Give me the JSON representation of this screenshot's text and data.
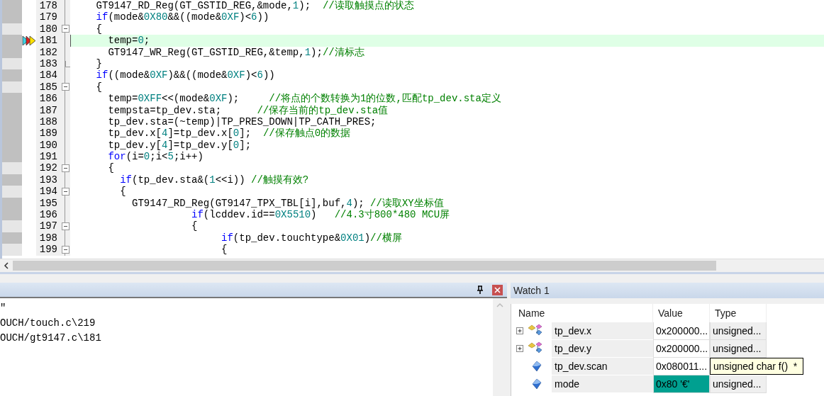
{
  "editor": {
    "lines": [
      {
        "number": "178",
        "executable": true,
        "current": false,
        "fold_start": false,
        "fold_end": false,
        "tokens": [
          {
            "kind": "code",
            "text": "    GT9147_RD_Reg(GT_GSTID_REG,&mode,"
          },
          {
            "kind": "number",
            "text": "1"
          },
          {
            "kind": "code",
            "text": ");  "
          },
          {
            "kind": "comment",
            "text": "//读取触摸点的状态"
          }
        ]
      },
      {
        "number": "179",
        "executable": true,
        "current": false,
        "fold_start": false,
        "fold_end": false,
        "tokens": [
          {
            "kind": "keyword",
            "text": "    if"
          },
          {
            "kind": "code",
            "text": "(mode&"
          },
          {
            "kind": "number",
            "text": "0X80"
          },
          {
            "kind": "code",
            "text": "&&((mode&"
          },
          {
            "kind": "number",
            "text": "0XF"
          },
          {
            "kind": "code",
            "text": ")<"
          },
          {
            "kind": "number",
            "text": "6"
          },
          {
            "kind": "code",
            "text": "))"
          }
        ]
      },
      {
        "number": "180",
        "executable": false,
        "current": false,
        "fold_start": true,
        "fold_end": false,
        "tokens": [
          {
            "kind": "code",
            "text": "    {"
          }
        ]
      },
      {
        "number": "181",
        "executable": true,
        "current": true,
        "fold_start": false,
        "fold_end": false,
        "tokens": [
          {
            "kind": "code",
            "text": "      temp="
          },
          {
            "kind": "number",
            "text": "0"
          },
          {
            "kind": "code",
            "text": ";"
          }
        ]
      },
      {
        "number": "182",
        "executable": true,
        "current": false,
        "fold_start": false,
        "fold_end": false,
        "tokens": [
          {
            "kind": "code",
            "text": "      GT9147_WR_Reg(GT_GSTID_REG,&temp,"
          },
          {
            "kind": "number",
            "text": "1"
          },
          {
            "kind": "code",
            "text": ");"
          },
          {
            "kind": "comment",
            "text": "//清标志"
          }
        ]
      },
      {
        "number": "183",
        "executable": false,
        "current": false,
        "fold_start": false,
        "fold_end": true,
        "tokens": [
          {
            "kind": "code",
            "text": "    }"
          }
        ]
      },
      {
        "number": "184",
        "executable": true,
        "current": false,
        "fold_start": false,
        "fold_end": false,
        "tokens": [
          {
            "kind": "keyword",
            "text": "    if"
          },
          {
            "kind": "code",
            "text": "((mode&"
          },
          {
            "kind": "number",
            "text": "0XF"
          },
          {
            "kind": "code",
            "text": ")&&((mode&"
          },
          {
            "kind": "number",
            "text": "0XF"
          },
          {
            "kind": "code",
            "text": ")<"
          },
          {
            "kind": "number",
            "text": "6"
          },
          {
            "kind": "code",
            "text": "))"
          }
        ]
      },
      {
        "number": "185",
        "executable": false,
        "current": false,
        "fold_start": true,
        "fold_end": false,
        "tokens": [
          {
            "kind": "code",
            "text": "    {"
          }
        ]
      },
      {
        "number": "186",
        "executable": true,
        "current": false,
        "fold_start": false,
        "fold_end": false,
        "tokens": [
          {
            "kind": "code",
            "text": "      temp="
          },
          {
            "kind": "number",
            "text": "0XFF"
          },
          {
            "kind": "code",
            "text": "<<(mode&"
          },
          {
            "kind": "number",
            "text": "0XF"
          },
          {
            "kind": "code",
            "text": ");     "
          },
          {
            "kind": "comment",
            "text": "//将点的个数转换为1的位数,匹配tp_dev.sta定义"
          }
        ]
      },
      {
        "number": "187",
        "executable": true,
        "current": false,
        "fold_start": false,
        "fold_end": false,
        "tokens": [
          {
            "kind": "code",
            "text": "      tempsta=tp_dev.sta;      "
          },
          {
            "kind": "comment",
            "text": "//保存当前的tp_dev.sta值"
          }
        ]
      },
      {
        "number": "188",
        "executable": true,
        "current": false,
        "fold_start": false,
        "fold_end": false,
        "tokens": [
          {
            "kind": "code",
            "text": "      tp_dev.sta=(~temp)|TP_PRES_DOWN|TP_CATH_PRES;"
          }
        ]
      },
      {
        "number": "189",
        "executable": true,
        "current": false,
        "fold_start": false,
        "fold_end": false,
        "tokens": [
          {
            "kind": "code",
            "text": "      tp_dev.x["
          },
          {
            "kind": "number",
            "text": "4"
          },
          {
            "kind": "code",
            "text": "]=tp_dev.x["
          },
          {
            "kind": "number",
            "text": "0"
          },
          {
            "kind": "code",
            "text": "];  "
          },
          {
            "kind": "comment",
            "text": "//保存触点0的数据"
          }
        ]
      },
      {
        "number": "190",
        "executable": true,
        "current": false,
        "fold_start": false,
        "fold_end": false,
        "tokens": [
          {
            "kind": "code",
            "text": "      tp_dev.y["
          },
          {
            "kind": "number",
            "text": "4"
          },
          {
            "kind": "code",
            "text": "]=tp_dev.y["
          },
          {
            "kind": "number",
            "text": "0"
          },
          {
            "kind": "code",
            "text": "];"
          }
        ]
      },
      {
        "number": "191",
        "executable": true,
        "current": false,
        "fold_start": false,
        "fold_end": false,
        "tokens": [
          {
            "kind": "keyword",
            "text": "      for"
          },
          {
            "kind": "code",
            "text": "(i="
          },
          {
            "kind": "number",
            "text": "0"
          },
          {
            "kind": "code",
            "text": ";i<"
          },
          {
            "kind": "number",
            "text": "5"
          },
          {
            "kind": "code",
            "text": ";i++)"
          }
        ]
      },
      {
        "number": "192",
        "executable": false,
        "current": false,
        "fold_start": true,
        "fold_end": false,
        "tokens": [
          {
            "kind": "code",
            "text": "      {"
          }
        ]
      },
      {
        "number": "193",
        "executable": true,
        "current": false,
        "fold_start": false,
        "fold_end": false,
        "tokens": [
          {
            "kind": "keyword",
            "text": "        if"
          },
          {
            "kind": "code",
            "text": "(tp_dev.sta&("
          },
          {
            "kind": "number",
            "text": "1"
          },
          {
            "kind": "code",
            "text": "<<i)) "
          },
          {
            "kind": "comment",
            "text": "//触摸有效?"
          }
        ]
      },
      {
        "number": "194",
        "executable": false,
        "current": false,
        "fold_start": true,
        "fold_end": false,
        "tokens": [
          {
            "kind": "code",
            "text": "        {"
          }
        ]
      },
      {
        "number": "195",
        "executable": true,
        "current": false,
        "fold_start": false,
        "fold_end": false,
        "tokens": [
          {
            "kind": "code",
            "text": "          GT9147_RD_Reg(GT9147_TPX_TBL[i],buf,"
          },
          {
            "kind": "number",
            "text": "4"
          },
          {
            "kind": "code",
            "text": "); "
          },
          {
            "kind": "comment",
            "text": "//读取XY坐标值"
          }
        ]
      },
      {
        "number": "196",
        "executable": true,
        "current": false,
        "fold_start": false,
        "fold_end": false,
        "tokens": [
          {
            "kind": "keyword",
            "text": "                    if"
          },
          {
            "kind": "code",
            "text": "(lcddev.id=="
          },
          {
            "kind": "number",
            "text": "0X5510"
          },
          {
            "kind": "code",
            "text": ")   "
          },
          {
            "kind": "comment",
            "text": "//4.3寸800*480 MCU屏"
          }
        ]
      },
      {
        "number": "197",
        "executable": false,
        "current": false,
        "fold_start": true,
        "fold_end": false,
        "tokens": [
          {
            "kind": "code",
            "text": "                    {"
          }
        ]
      },
      {
        "number": "198",
        "executable": true,
        "current": false,
        "fold_start": false,
        "fold_end": false,
        "tokens": [
          {
            "kind": "keyword",
            "text": "                         if"
          },
          {
            "kind": "code",
            "text": "(tp_dev.touchtype&"
          },
          {
            "kind": "number",
            "text": "0X01"
          },
          {
            "kind": "code",
            "text": ")"
          },
          {
            "kind": "comment",
            "text": "//横屏"
          }
        ]
      },
      {
        "number": "199",
        "executable": false,
        "current": false,
        "fold_start": true,
        "fold_end": false,
        "tokens": [
          {
            "kind": "code",
            "text": "                         {"
          }
        ]
      }
    ]
  },
  "output": {
    "lines": [
      "\"",
      "OUCH/touch.c\\219",
      "OUCH/gt9147.c\\181"
    ]
  },
  "watch": {
    "title": "Watch 1",
    "columns": [
      "Name",
      "Value",
      "Type"
    ],
    "rows": [
      {
        "kind": "struct",
        "name": "tp_dev.x",
        "value": "0x200000...",
        "type": "unsigned...",
        "changed": false,
        "tooltip": false
      },
      {
        "kind": "struct",
        "name": "tp_dev.y",
        "value": "0x200000...",
        "type": "unsigned...",
        "changed": false,
        "tooltip": false
      },
      {
        "kind": "variable",
        "name": "tp_dev.scan",
        "value": "0x080011...",
        "type": "unsigned char f()  *",
        "changed": false,
        "tooltip": true
      },
      {
        "kind": "variable",
        "name": "mode",
        "value": "0x80 '€'",
        "type": "unsigned...",
        "changed": true,
        "tooltip": false
      }
    ]
  }
}
